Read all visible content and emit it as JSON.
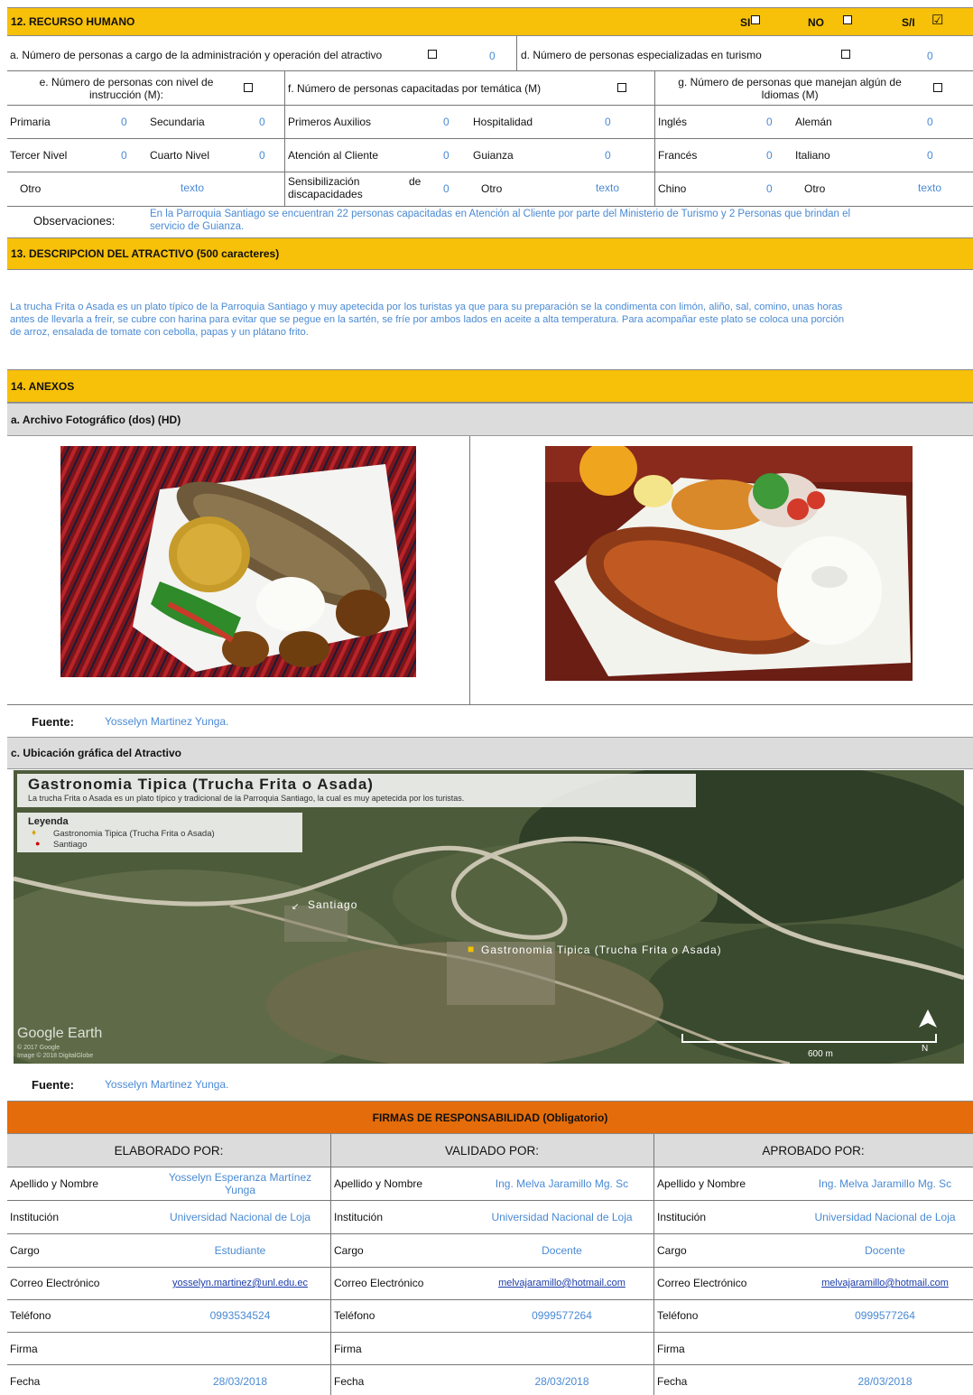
{
  "s12": {
    "title": "12. RECURSO HUMANO",
    "si": "SI",
    "no": "NO",
    "sn": "S/I",
    "sn_check": "☑",
    "a_label": "a. Número de personas a cargo de la administración y operación del atractivo",
    "a_val": "0",
    "d_label": "d. Número de personas especializadas en turismo",
    "d_val": "0",
    "e_label_1": "e. Número de personas con nivel de",
    "e_label_2": "instrucción (M):",
    "f_label": "f. Número de personas capacitadas por temática (M)",
    "g_label_1": "g. Número de personas que manejan algún de",
    "g_label_2": "Idiomas (M)",
    "rows": [
      [
        "Primaria",
        "0",
        "Secundaria",
        "0",
        "Primeros Auxilios",
        "0",
        "Hospitalidad",
        "0",
        "Inglés",
        "0",
        "Alemán",
        "0"
      ],
      [
        "Tercer Nivel",
        "0",
        "Cuarto Nivel",
        "0",
        "Atención al Cliente",
        "0",
        "Guianza",
        "0",
        "Francés",
        "0",
        "Italiano",
        "0"
      ]
    ],
    "otro": "Otro",
    "texto": "texto",
    "sens_1": "Sensibilización",
    "sens_de": "de",
    "sens_2": "discapacidades",
    "sens_val": "0",
    "chino": "Chino",
    "chino_val": "0",
    "obs_label": "Observaciones:",
    "obs_1": "En la Parroquia Santiago se encuentran 22  personas capacitadas en Atención al Cliente  por parte del Ministerio de Turismo y 2 Personas que brindan el",
    "obs_2": "servicio de Guianza."
  },
  "s13": {
    "title": "13. DESCRIPCION DEL ATRACTIVO (500 caracteres)",
    "l1": "La trucha Frita o Asada es un plato típico de la Parroquia Santiago y muy apetecida por los turistas  ya que para su preparación se la condimenta con limón, aliño, sal, comino, unas horas",
    "l2": "antes de llevarla a freír, se cubre con harina para evitar que se pegue en la sartén, se fríe por ambos lados en aceite a alta temperatura. Para acompañar este plato se coloca una porción",
    "l3": "de arroz, ensalada de tomate con cebolla, papas y un plátano frito."
  },
  "s14": {
    "title": "14. ANEXOS",
    "foto_title": "a. Archivo Fotográfico (dos) (HD)",
    "fuente_label": "Fuente:",
    "fuente": "Yosselyn Martinez Yunga.",
    "map_section": "c. Ubicación gráfica del Atractivo",
    "map_title": "Gastronomia Tipica (Trucha Frita o Asada)",
    "map_sub": "La trucha Frita o Asada es un plato típico y tradicional de la Parroquia Santiago, la cual es muy apetecida por los turistas.",
    "leyenda": "Leyenda",
    "leg1": "Gastronomia Tipica (Trucha Frita o Asada)",
    "leg2": "Santiago",
    "pin_santiago": "Santiago",
    "pin_gastro": "Gastronomia Tipica (Trucha Frita o Asada)",
    "google": "Google Earth",
    "credit1": "© 2017 Google",
    "credit2": "Image © 2018 DigitalGlobe",
    "scale": "600 m",
    "north": "N"
  },
  "firmas": {
    "title": "FIRMAS DE RESPONSABILIDAD (Obligatorio)",
    "headers": [
      "ELABORADO POR:",
      "VALIDADO  POR:",
      "APROBADO POR:"
    ],
    "labels": [
      "Apellido y Nombre",
      "Institución",
      "Cargo",
      "Correo Electrónico",
      "Teléfono",
      "Firma",
      "Fecha"
    ],
    "col1": [
      "Yosselyn Esperanza Martínez",
      "Yunga",
      "Universidad Nacional de Loja",
      "Estudiante",
      "yosselyn.martinez@unl.edu.ec",
      "0993534524",
      "",
      "28/03/2018"
    ],
    "col2": [
      "Ing. Melva Jaramillo Mg. Sc",
      "Universidad Nacional de Loja",
      "Docente",
      "melvajaramillo@hotmail.com",
      "0999577264",
      "",
      "28/03/2018"
    ],
    "col3": [
      "Ing. Melva Jaramillo Mg. Sc",
      "Universidad Nacional de Loja",
      "Docente",
      "melvajaramillo@hotmail.com",
      "0999577264",
      "",
      "28/03/2018"
    ]
  },
  "colors": {
    "band": "#f7c009",
    "orange": "#e46c0a",
    "value_blue": "#4a8ad4",
    "gray": "#dcdcdc"
  }
}
